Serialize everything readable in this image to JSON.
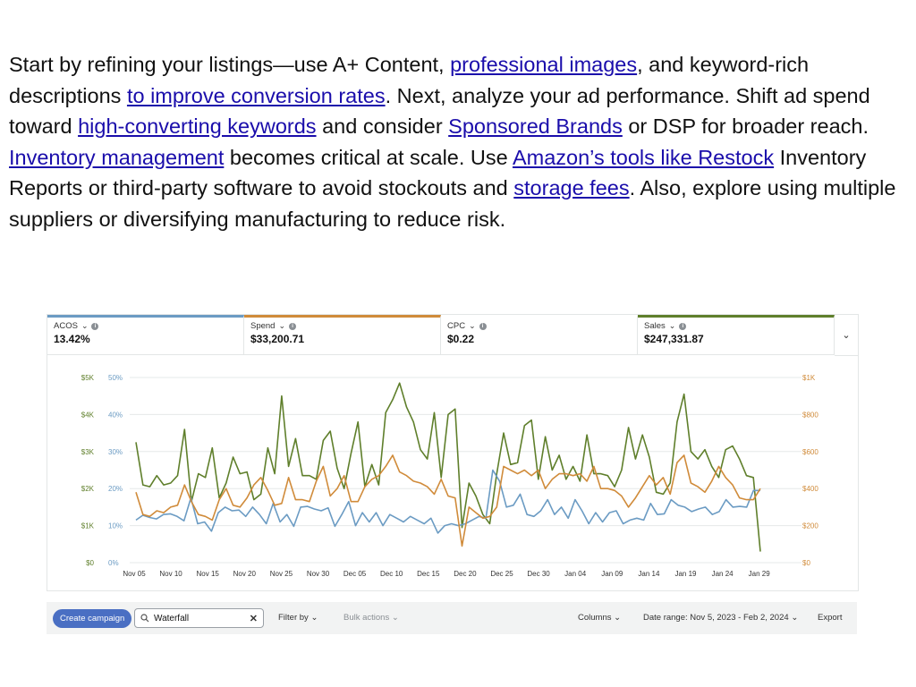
{
  "article": {
    "p1": {
      "t1": "Start by refining your listings—use A+ Content, ",
      "l1": "professional images",
      "t2": ", and keyword-rich descriptions ",
      "l2": "to improve conversion rates",
      "t3": ". Next, analyze your ad performance. Shift ad spend toward ",
      "l3": "high-converting keywords",
      "t4": " and consider ",
      "l4": "Sponsored Brands",
      "t5": " or DSP for broader reach."
    },
    "p2": {
      "l1": "Inventory management",
      "t1": " becomes critical at scale. Use ",
      "l2": "Amazon’s tools like Restock",
      "t2": " Inventory Reports or third-party software to avoid stockouts and ",
      "l3": "storage fees",
      "t3": ". Also, explore using multiple suppliers or diversifying manufacturing to reduce risk."
    }
  },
  "metrics": [
    {
      "label": "ACOS",
      "value": "13.42%",
      "color": "#6b9bc3"
    },
    {
      "label": "Spend",
      "value": "$33,200.71",
      "color": "#d08b3a"
    },
    {
      "label": "CPC",
      "value": "$0.22",
      "color": ""
    },
    {
      "label": "Sales",
      "value": "$247,331.87",
      "color": "#5f7f2b"
    }
  ],
  "icons": {
    "expand": "chevron-down-icon",
    "info": "info-icon",
    "search": "search-icon",
    "clear": "close-icon"
  },
  "chart_data": {
    "type": "line",
    "x_ticks": [
      "Nov 05",
      "Nov 10",
      "Nov 15",
      "Nov 20",
      "Nov 25",
      "Nov 30",
      "Dec 05",
      "Dec 10",
      "Dec 15",
      "Dec 20",
      "Dec 25",
      "Dec 30",
      "Jan 04",
      "Jan 09",
      "Jan 14",
      "Jan 19",
      "Jan 24",
      "Jan 29"
    ],
    "date_range": [
      "2023-11-05",
      "2024-02-02"
    ],
    "axes": {
      "left_sales": {
        "ticks": [
          "$0",
          "$1K",
          "$2K",
          "$3K",
          "$4K",
          "$5K"
        ],
        "range": [
          0,
          5000
        ]
      },
      "left_acos": {
        "ticks": [
          "0%",
          "10%",
          "20%",
          "30%",
          "40%",
          "50%"
        ],
        "range": [
          0,
          50
        ]
      },
      "right_spend": {
        "ticks": [
          "$0",
          "$200",
          "$400",
          "$600",
          "$800",
          "$1K"
        ],
        "range": [
          0,
          1000
        ]
      }
    },
    "grid": true,
    "series": [
      {
        "name": "Sales",
        "axis": "left_sales",
        "color": "#5f7f2b",
        "values": [
          3250,
          2100,
          2050,
          2350,
          2100,
          2150,
          2350,
          3600,
          1650,
          2400,
          2300,
          3100,
          1750,
          2150,
          2850,
          2400,
          2450,
          1700,
          1850,
          3100,
          2400,
          4500,
          2600,
          3350,
          2350,
          2350,
          2250,
          3300,
          3550,
          2550,
          2000,
          2950,
          3800,
          2050,
          2650,
          2100,
          4050,
          4400,
          4850,
          4200,
          3800,
          3050,
          2800,
          4050,
          2300,
          4000,
          4150,
          950,
          2150,
          1800,
          1300,
          1050,
          2400,
          3500,
          2650,
          2700,
          3700,
          3850,
          2250,
          3400,
          2500,
          2900,
          2250,
          2600,
          2200,
          3450,
          2400,
          2400,
          2350,
          2050,
          2500,
          3650,
          2800,
          3450,
          2850,
          1900,
          1850,
          2150,
          3800,
          4550,
          3000,
          2800,
          3050,
          2600,
          2300,
          3050,
          3150,
          2800,
          2350,
          2300,
          300
        ]
      },
      {
        "name": "ACOS",
        "axis": "left_acos",
        "color": "#6b9bc3",
        "values": [
          11.5,
          12.8,
          12.2,
          11.8,
          13.0,
          13.2,
          12.5,
          11.3,
          17.5,
          10.5,
          11.0,
          8.5,
          13.5,
          15.0,
          14.0,
          14.2,
          12.5,
          15.0,
          13.0,
          10.5,
          16.0,
          11.0,
          13.0,
          9.8,
          15.0,
          15.2,
          14.5,
          14.0,
          14.8,
          9.8,
          13.0,
          16.5,
          10.0,
          13.5,
          11.0,
          13.5,
          10.0,
          13.0,
          12.0,
          11.0,
          12.5,
          11.5,
          10.5,
          12.0,
          8.0,
          10.0,
          10.5,
          10.0,
          10.5,
          11.5,
          12.5,
          12.0,
          25.0,
          22.0,
          15.0,
          15.5,
          18.5,
          13.0,
          12.5,
          14.0,
          17.0,
          13.0,
          15.0,
          12.0,
          17.0,
          14.0,
          10.5,
          13.5,
          11.0,
          13.5,
          14.0,
          10.5,
          11.5,
          12.0,
          11.5,
          16.0,
          13.0,
          13.2,
          17.0,
          15.5,
          15.0,
          13.8,
          14.5,
          15.0,
          13.0,
          13.8,
          17.0,
          15.0,
          15.2,
          15.0,
          19.5,
          19.5
        ]
      },
      {
        "name": "Spend",
        "axis": "right_spend",
        "color": "#d08b3a",
        "values": [
          380,
          260,
          250,
          280,
          270,
          300,
          310,
          420,
          330,
          260,
          250,
          230,
          340,
          400,
          310,
          300,
          350,
          420,
          460,
          390,
          310,
          320,
          460,
          340,
          340,
          330,
          440,
          520,
          360,
          400,
          470,
          330,
          330,
          410,
          450,
          470,
          520,
          580,
          490,
          470,
          440,
          430,
          410,
          370,
          450,
          360,
          350,
          90,
          300,
          270,
          240,
          250,
          300,
          520,
          500,
          480,
          500,
          470,
          500,
          400,
          450,
          480,
          480,
          470,
          480,
          440,
          520,
          400,
          400,
          390,
          360,
          300,
          350,
          410,
          470,
          420,
          460,
          370,
          540,
          580,
          430,
          410,
          380,
          440,
          520,
          460,
          420,
          350,
          340,
          340,
          400
        ]
      }
    ]
  },
  "toolbar": {
    "create_campaign": "Create campaign",
    "search_value": "Waterfall",
    "filter_by": "Filter by",
    "bulk_actions": "Bulk actions",
    "columns": "Columns",
    "date_range": "Date range: Nov 5, 2023 - Feb 2, 2024",
    "export": "Export"
  }
}
